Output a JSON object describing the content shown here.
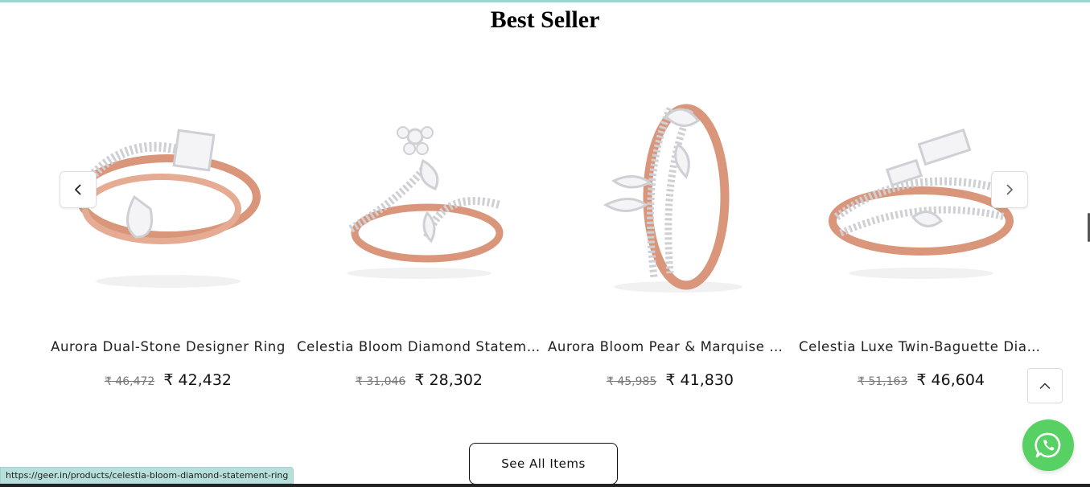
{
  "section": {
    "title": "Best Seller"
  },
  "products": [
    {
      "name": "Aurora Dual-Stone Designer Ring",
      "old_price": "₹ 46,472",
      "price": "₹ 42,432"
    },
    {
      "name": "Celestia Bloom Diamond Statement Ring",
      "old_price": "₹ 31,046",
      "price": "₹ 28,302"
    },
    {
      "name": "Aurora Bloom Pear & Marquise Diamond Ring",
      "old_price": "₹ 45,985",
      "price": "₹ 41,830"
    },
    {
      "name": "Celestia Luxe Twin-Baguette Diamond Ring",
      "old_price": "₹ 51,163",
      "price": "₹ 46,604"
    }
  ],
  "buttons": {
    "see_all": "See All Items"
  },
  "icons": {
    "prev": "chevron-left-icon",
    "next": "chevron-right-icon",
    "scroll_top": "chevron-up-icon",
    "whatsapp": "whatsapp-icon"
  },
  "status_bar": {
    "url": "https://geer.in/products/celestia-bloom-diamond-statement-ring"
  },
  "colors": {
    "accent_whatsapp": "#57d163",
    "gold": "#d9967a",
    "top_line": "#9fd6d4"
  }
}
